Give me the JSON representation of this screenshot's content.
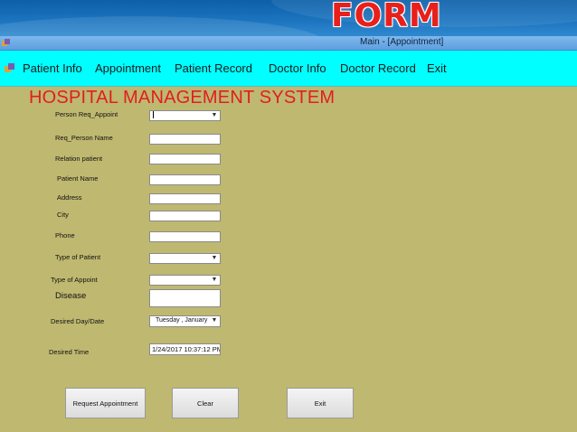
{
  "banner": {
    "title": "FORM"
  },
  "window": {
    "title": "Main - [Appointment]"
  },
  "menu": {
    "items": [
      {
        "label": "Patient Info"
      },
      {
        "label": "Appointment"
      },
      {
        "label": "Patient  Record"
      },
      {
        "label": "Doctor Info"
      },
      {
        "label": "Doctor Record"
      },
      {
        "label": "Exit"
      }
    ]
  },
  "form": {
    "title": "HOSPITAL MANAGEMENT SYSTEM",
    "labels": {
      "person_req": "Person Req_Appoint",
      "req_person_name": "Req_Person Name",
      "relation_patient": "Relation patient",
      "patient_name": "Patient Name",
      "address": "Address",
      "city": "City",
      "phone": "Phone",
      "type_of_patient": "Type of Patient",
      "type_of_appoint": "Type of Appoint",
      "disease": "Disease",
      "desired_day": "Desired Day/Date",
      "desired_time": "Desired Time"
    },
    "values": {
      "desired_day": "Tuesday  ,  January",
      "desired_time": "1/24/2017 10:37:12 PM"
    },
    "buttons": {
      "request": "Request Appointment",
      "clear": "Clear",
      "exit": "Exit"
    }
  },
  "colors": {
    "form_background": "#bfb870",
    "menubar": "#00ffff",
    "title_red": "#e01e22",
    "banner_blue": "#1b73be"
  }
}
